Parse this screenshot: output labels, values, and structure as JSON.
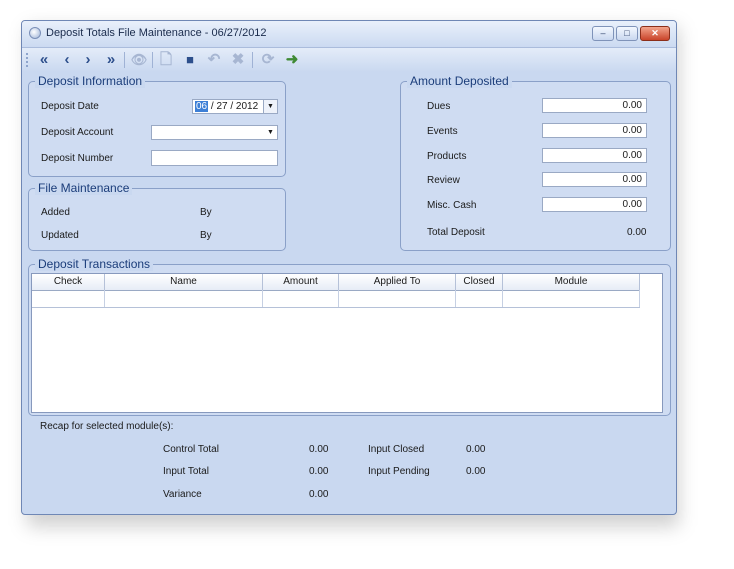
{
  "window": {
    "title": "Deposit Totals File Maintenance - 06/27/2012",
    "minimize_label": "–",
    "restore_label": "□",
    "close_label": "✕"
  },
  "toolbar": {
    "icons": [
      "first-record-icon",
      "previous-record-icon",
      "next-record-icon",
      "last-record-icon",
      "view-icon",
      "new-icon",
      "save-icon",
      "undo-icon",
      "delete-icon",
      "refresh-icon",
      "exit-icon"
    ]
  },
  "deposit_information": {
    "legend": "Deposit Information",
    "date_label": "Deposit Date",
    "date_month": "06",
    "date_rest": " / 27 / 2012",
    "account_label": "Deposit Account",
    "account_value": "",
    "number_label": "Deposit Number",
    "number_value": ""
  },
  "file_maintenance": {
    "legend": "File Maintenance",
    "added_label": "Added",
    "added_by_label": "By",
    "updated_label": "Updated",
    "updated_by_label": "By"
  },
  "amount_deposited": {
    "legend": "Amount Deposited",
    "dues_label": "Dues",
    "dues_value": "0.00",
    "events_label": "Events",
    "events_value": "0.00",
    "products_label": "Products",
    "products_value": "0.00",
    "review_label": "Review",
    "review_value": "0.00",
    "misc_label": "Misc. Cash",
    "misc_value": "0.00",
    "total_label": "Total Deposit",
    "total_value": "0.00"
  },
  "transactions": {
    "legend": "Deposit Transactions",
    "columns": [
      "Check",
      "Name",
      "Amount",
      "Applied To",
      "Closed",
      "Module"
    ]
  },
  "recap": {
    "heading": "Recap for selected module(s):",
    "control_total_label": "Control Total",
    "control_total_value": "0.00",
    "input_total_label": "Input Total",
    "input_total_value": "0.00",
    "variance_label": "Variance",
    "variance_value": "0.00",
    "input_closed_label": "Input Closed",
    "input_closed_value": "0.00",
    "input_pending_label": "Input Pending",
    "input_pending_value": "0.00"
  }
}
